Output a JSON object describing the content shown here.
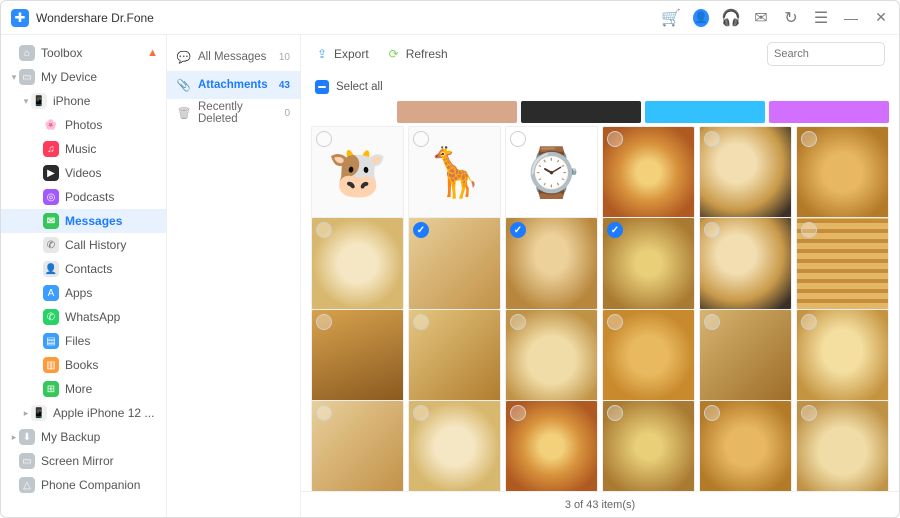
{
  "app": {
    "title": "Wondershare Dr.Fone"
  },
  "sidebar": {
    "items": [
      {
        "label": "Toolbox",
        "icon_bg": "#bfc6cc",
        "glyph": "⌂",
        "chev": "",
        "ind": 0,
        "flame": true
      },
      {
        "label": "My Device",
        "icon_bg": "#bfc6cc",
        "glyph": "▭",
        "chev": "▾",
        "ind": 0
      },
      {
        "label": "iPhone",
        "icon_bg": "#f0f0f0",
        "glyph": "📱",
        "chev": "▾",
        "ind": 1
      },
      {
        "label": "Photos",
        "icon_bg": "#ffffff",
        "glyph": "🌸",
        "chev": "",
        "ind": 2
      },
      {
        "label": "Music",
        "icon_bg": "#ff3b5c",
        "glyph": "♫",
        "chev": "",
        "ind": 2
      },
      {
        "label": "Videos",
        "icon_bg": "#2b2b2b",
        "glyph": "▶",
        "chev": "",
        "ind": 2
      },
      {
        "label": "Podcasts",
        "icon_bg": "#a259ff",
        "glyph": "◎",
        "chev": "",
        "ind": 2
      },
      {
        "label": "Messages",
        "icon_bg": "#35c759",
        "glyph": "✉",
        "chev": "",
        "ind": 2,
        "active": true
      },
      {
        "label": "Call History",
        "icon_bg": "#e7e7e7",
        "glyph": "✆",
        "chev": "",
        "ind": 2
      },
      {
        "label": "Contacts",
        "icon_bg": "#e7e7e7",
        "glyph": "👤",
        "chev": "",
        "ind": 2
      },
      {
        "label": "Apps",
        "icon_bg": "#3b9dff",
        "glyph": "A",
        "chev": "",
        "ind": 2
      },
      {
        "label": "WhatsApp",
        "icon_bg": "#25d366",
        "glyph": "✆",
        "chev": "",
        "ind": 2
      },
      {
        "label": "Files",
        "icon_bg": "#3b9dff",
        "glyph": "▤",
        "chev": "",
        "ind": 2
      },
      {
        "label": "Books",
        "icon_bg": "#ff9a3b",
        "glyph": "▥",
        "chev": "",
        "ind": 2
      },
      {
        "label": "More",
        "icon_bg": "#35c759",
        "glyph": "⊞",
        "chev": "",
        "ind": 2
      },
      {
        "label": "Apple iPhone 12 ...",
        "icon_bg": "#f0f0f0",
        "glyph": "📱",
        "chev": "▸",
        "ind": 1
      },
      {
        "label": "My Backup",
        "icon_bg": "#bfc6cc",
        "glyph": "⬇",
        "chev": "▸",
        "ind": 0
      },
      {
        "label": "Screen Mirror",
        "icon_bg": "#bfc6cc",
        "glyph": "▭",
        "chev": "",
        "ind": 0
      },
      {
        "label": "Phone Companion",
        "icon_bg": "#bfc6cc",
        "glyph": "△",
        "chev": "",
        "ind": 0
      }
    ]
  },
  "mid": {
    "items": [
      {
        "label": "All Messages",
        "count": "10",
        "active": false
      },
      {
        "label": "Attachments",
        "count": "43",
        "active": true
      },
      {
        "label": "Recently Deleted",
        "count": "0",
        "active": false
      }
    ]
  },
  "toolbar": {
    "export": "Export",
    "refresh": "Refresh",
    "search_placeholder": "Search"
  },
  "selectall": {
    "label": "Select all"
  },
  "topstrip": [
    {
      "bg": "#d8a78a"
    },
    {
      "bg": "#2b2b2b"
    },
    {
      "bg": "#33c0ff"
    },
    {
      "bg": "#d36fff"
    }
  ],
  "thumbs": [
    {
      "cls": "memoji1",
      "sel": false,
      "emoji": "🐮"
    },
    {
      "cls": "memoji2",
      "sel": false,
      "emoji": "🦒"
    },
    {
      "cls": "watch",
      "sel": false,
      "emoji": "⌚"
    },
    {
      "cls": "pizza",
      "sel": false
    },
    {
      "cls": "food2",
      "sel": false
    },
    {
      "cls": "samosa",
      "sel": false
    },
    {
      "cls": "food4",
      "sel": false
    },
    {
      "cls": "food3",
      "sel": true
    },
    {
      "cls": "bread",
      "sel": true
    },
    {
      "cls": "food6",
      "sel": true
    },
    {
      "cls": "food2",
      "sel": false
    },
    {
      "cls": "pancake",
      "sel": false
    },
    {
      "cls": "food5",
      "sel": false
    },
    {
      "cls": "food7",
      "sel": false
    },
    {
      "cls": "food8",
      "sel": false
    },
    {
      "cls": "food1",
      "sel": false
    },
    {
      "cls": "food9",
      "sel": false
    },
    {
      "cls": "food10",
      "sel": false
    },
    {
      "cls": "food3",
      "sel": false
    },
    {
      "cls": "food4",
      "sel": false
    },
    {
      "cls": "pizza",
      "sel": false
    },
    {
      "cls": "food6",
      "sel": false
    },
    {
      "cls": "samosa",
      "sel": false
    },
    {
      "cls": "food8",
      "sel": false
    }
  ],
  "status": {
    "text": "3  of  43  item(s)"
  }
}
